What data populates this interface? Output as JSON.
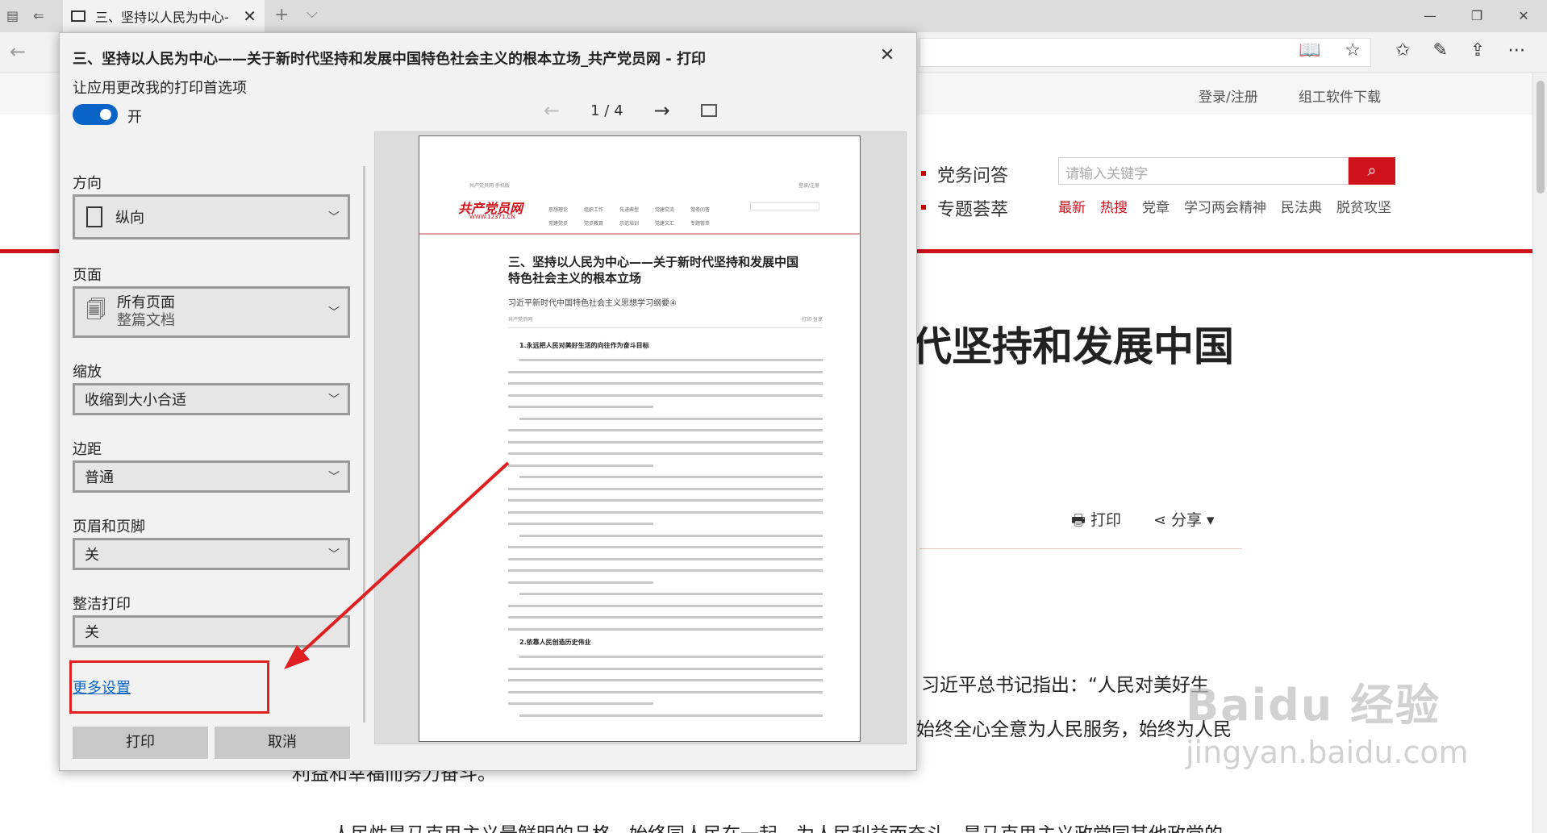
{
  "browser": {
    "tab_title": "三、坚持以人民为中心-",
    "new_tab": "+",
    "tab_list": "⌵",
    "window_controls": [
      "—",
      "❐",
      "✕"
    ]
  },
  "website": {
    "login": "登录/注册",
    "software": "组工软件下载",
    "nav1": "党务问答",
    "nav2": "专题荟萃",
    "search_placeholder": "请输入关键字",
    "hot_links": [
      {
        "label": "最新",
        "red": true
      },
      {
        "label": "热搜",
        "red": true
      },
      {
        "label": "党章",
        "red": false
      },
      {
        "label": "学习两会精神",
        "red": false
      },
      {
        "label": "民法典",
        "red": false
      },
      {
        "label": "脱贫攻坚",
        "red": false
      }
    ],
    "headline_fragment": "代坚持和发展中国",
    "print_label": "打印",
    "share_label": "分享",
    "para1": "习近平总书记指出：“人民对美好生",
    "para2": "始终全心全意为人民服务，始终为人民",
    "para3": "利益和幸福而努力奋斗。",
    "para4": "人民性是马克思主义最鲜明的品格。始终同人民在一起，为人民利益而奋斗，是马克思主义政党同其他政党的"
  },
  "watermark": {
    "line1": "Baidu 经验",
    "line2": "jingyan.baidu.com"
  },
  "print_dialog": {
    "title": "三、坚持以人民为中心——关于新时代坚持和发展中国特色社会主义的根本立场_共产党员网 - 打印",
    "close": "✕",
    "preference_label": "让应用更改我的打印首选项",
    "toggle_state": "开",
    "orientation": {
      "label": "方向",
      "value": "纵向"
    },
    "pages": {
      "label": "页面",
      "value": "所有页面",
      "subvalue": "整篇文档"
    },
    "scale": {
      "label": "缩放",
      "value": "收缩到大小合适"
    },
    "margins": {
      "label": "边距",
      "value": "普通"
    },
    "header_footer": {
      "label": "页眉和页脚",
      "value": "关"
    },
    "clean_print": {
      "label": "整洁打印",
      "value": "关"
    },
    "more_settings": "更多设置",
    "print_button": "打印",
    "cancel_button": "取消",
    "page_indicator": "1 / 4",
    "preview": {
      "brand": "共产党员网",
      "brand_url": "WWW.12371.CN",
      "article_title": "三、坚持以人民为中心——关于新时代坚持和发展中国特色社会主义的根本立场",
      "article_subtitle": "习近平新时代中国特色社会主义思想学习纲要④",
      "meta_left": "共产党员网",
      "meta_right": "打印    分享",
      "section1": "1.永远把人民对美好生活的向往作为奋斗目标",
      "section2": "2.依靠人民创造历史伟业",
      "menu": [
        "思想理论",
        "组织工作",
        "先进典型",
        "党建交流",
        "党务问答",
        "党建党员",
        "党员教育",
        "示范培训",
        "党建文汇",
        "专题荟萃"
      ]
    }
  }
}
